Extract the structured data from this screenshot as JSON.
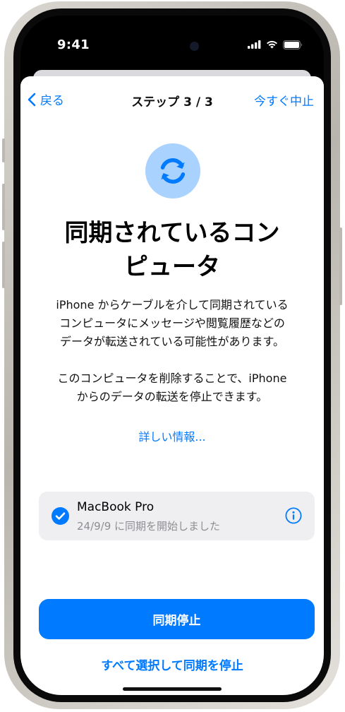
{
  "status_bar": {
    "time": "9:41",
    "icons": [
      "cellular-signal-icon",
      "wifi-icon",
      "battery-icon"
    ]
  },
  "nav": {
    "back_label": "戻る",
    "title": "ステップ 3 / 3",
    "stop_now_label": "今すぐ中止"
  },
  "hero": {
    "icon": "sync-icon"
  },
  "headline": {
    "line1": "同期されているコン",
    "line2": "ピュータ"
  },
  "body": {
    "paragraph1": {
      "line1": "iPhone からケーブルを介して同期されている",
      "line2": "コンピュータにメッセージや閲覧履歴などの",
      "line3": "データが転送されている可能性があります。"
    },
    "paragraph2": {
      "line1": "このコンピュータを削除することで、iPhone",
      "line2": "からのデータの転送を停止できます。"
    }
  },
  "learn_more": "詳しい情報...",
  "device": {
    "name": "MacBook Pro",
    "subtitle": "24/9/9 に同期を開始しました",
    "selected": true
  },
  "actions": {
    "primary": "同期停止",
    "secondary": "すべて選択して同期を停止"
  },
  "colors": {
    "accent": "#007aff",
    "icon_circle": "#a9d2ff",
    "card_background": "#efeff1",
    "secondary_text": "#8e8e93"
  }
}
